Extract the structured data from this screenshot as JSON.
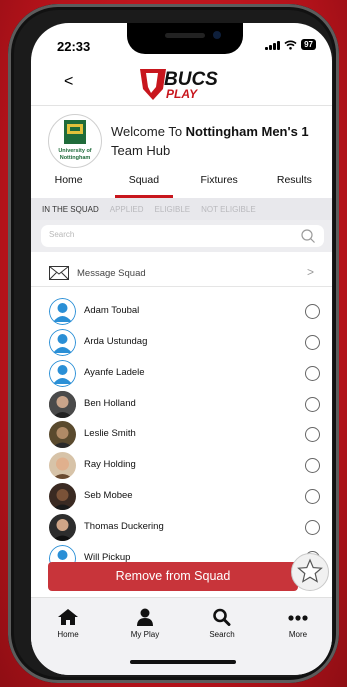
{
  "status": {
    "time": "22:33",
    "battery": "97"
  },
  "nav": {
    "back": "<",
    "logo_top": "BUCS",
    "logo_bottom": "PLAY"
  },
  "hub": {
    "welcome": "Welcome To ",
    "team": "Nottingham Men's 1",
    "suffix": "Team Hub",
    "crest_text_1": "University of",
    "crest_text_2": "Nottingham"
  },
  "tabs": [
    {
      "label": "Home"
    },
    {
      "label": "Squad"
    },
    {
      "label": "Fixtures"
    },
    {
      "label": "Results"
    }
  ],
  "subtabs": [
    {
      "label": "IN THE SQUAD"
    },
    {
      "label": "APPLIED"
    },
    {
      "label": "ELIGIBLE"
    },
    {
      "label": "NOT ELIGIBLE"
    }
  ],
  "search": {
    "placeholder": "Search"
  },
  "message": {
    "label": "Message Squad",
    "chevron": ">"
  },
  "players": [
    {
      "name": "Adam Toubal",
      "avatar": "placeholder"
    },
    {
      "name": "Arda Ustundag",
      "avatar": "placeholder"
    },
    {
      "name": "Ayanfe Ladele",
      "avatar": "placeholder"
    },
    {
      "name": "Ben Holland",
      "avatar": "photo"
    },
    {
      "name": "Leslie Smith",
      "avatar": "photo"
    },
    {
      "name": "Ray Holding",
      "avatar": "photo"
    },
    {
      "name": "Seb Mobee",
      "avatar": "photo"
    },
    {
      "name": "Thomas Duckering",
      "avatar": "photo"
    },
    {
      "name": "Will Pickup",
      "avatar": "placeholder"
    }
  ],
  "actions": {
    "remove": "Remove from Squad"
  },
  "bottom_nav": [
    {
      "label": "Home",
      "icon": "home-icon"
    },
    {
      "label": "My Play",
      "icon": "person-icon"
    },
    {
      "label": "Search",
      "icon": "search-icon"
    },
    {
      "label": "More",
      "icon": "more-icon"
    }
  ],
  "colors": {
    "accent": "#c8161d",
    "button": "#c8343a",
    "avatar_blue": "#2a8fd6"
  }
}
